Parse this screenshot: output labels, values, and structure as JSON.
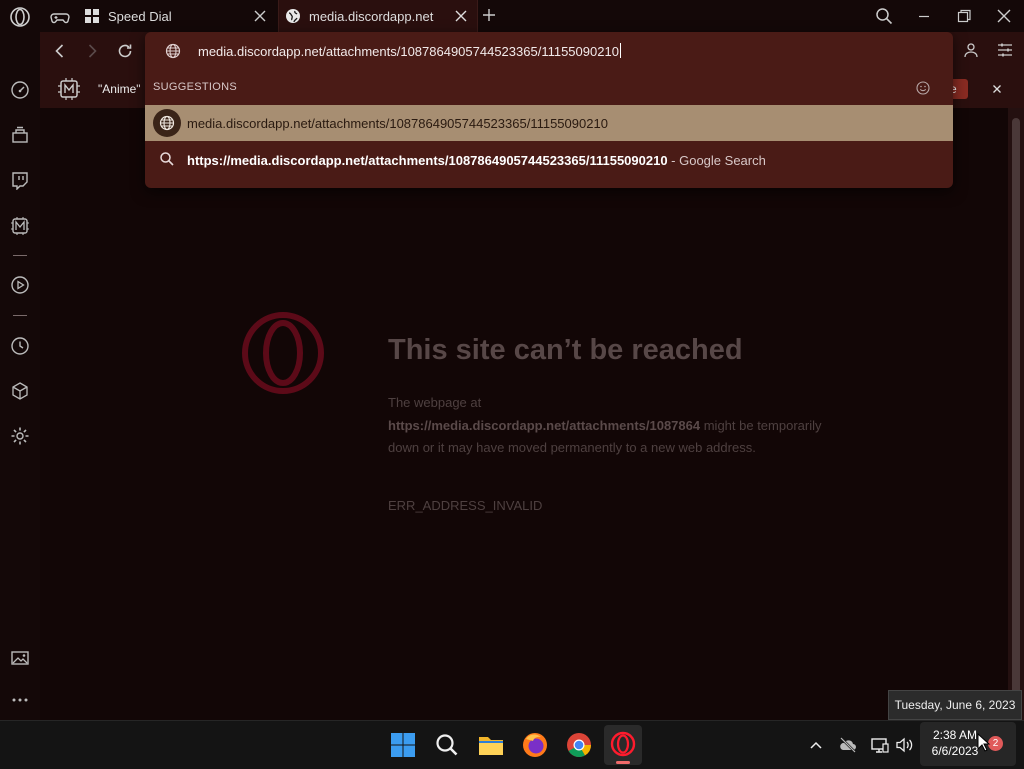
{
  "tabs": [
    {
      "label": "Speed Dial"
    },
    {
      "label": "media.discordapp.net"
    }
  ],
  "addressbar": {
    "value": "media.discordapp.net/attachments/1087864905744523365/11155090210"
  },
  "bookmarks": {
    "first_label": "\"Anime\"",
    "cut_button_label": "e"
  },
  "omnibox": {
    "header": "SUGGESTIONS",
    "suggestions": [
      {
        "icon": "globe-icon",
        "text": "media.discordapp.net/attachments/1087864905744523365/11155090210"
      },
      {
        "icon": "search-icon",
        "bold": "https://media.discordapp.net/attachments/1087864905744523365/11155090210",
        "suffix": " - Google Search"
      }
    ]
  },
  "error_page": {
    "title": "This site can’t be reached",
    "line1": "The webpage at",
    "url": "https://media.discordapp.net/attachments/1087864",
    "rest": " might be temporarily down or it may have moved permanently to a new web address.",
    "code": "ERR_ADDRESS_INVALID"
  },
  "taskbar": {
    "tooltip": "Tuesday, June 6, 2023",
    "time": "2:38 AM",
    "date": "6/6/2023",
    "notification_count": "2"
  },
  "colors": {
    "accent": "#c0142c",
    "selected_suggestion": "#a78e72",
    "omnibox_bg": "#4a1b16"
  }
}
